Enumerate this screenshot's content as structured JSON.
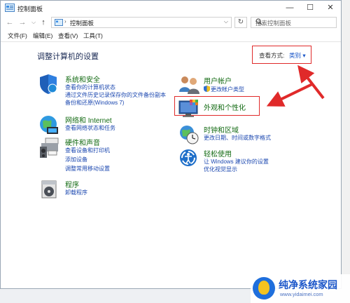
{
  "window": {
    "title": "控制面板"
  },
  "titlebar": {
    "minimize": "—",
    "maximize": "☐",
    "close": "✕"
  },
  "nav": {
    "back": "←",
    "forward": "→",
    "up": "↑"
  },
  "address": {
    "breadcrumb": "控制面板",
    "separator": "›",
    "dropdown": "⌵",
    "refresh": "↻"
  },
  "search": {
    "placeholder": "搜索控制面板"
  },
  "menu": [
    "文件(F)",
    "编辑(E)",
    "查看(V)",
    "工具(T)"
  ],
  "content": {
    "heading": "调整计算机的设置",
    "view_by_label": "查看方式:",
    "view_by_value": "类别 ▾"
  },
  "categories": {
    "system_security": {
      "title": "系统和安全",
      "links": [
        "查看你的计算机状态",
        "通过文件历史记录保存你的文件备份副本",
        "备份和还原(Windows 7)"
      ]
    },
    "network": {
      "title": "网络和 Internet",
      "links": [
        "查看网络状态和任务"
      ]
    },
    "hardware": {
      "title": "硬件和声音",
      "links": [
        "查看设备和打印机",
        "添加设备",
        "调整常用移动设置"
      ]
    },
    "programs": {
      "title": "程序",
      "links": [
        "卸载程序"
      ]
    },
    "user_accounts": {
      "title": "用户帐户",
      "links": [
        "更改帐户类型"
      ]
    },
    "appearance": {
      "title": "外观和个性化"
    },
    "clock_region": {
      "title": "时钟和区域",
      "links": [
        "更改日期、时间或数字格式"
      ]
    },
    "ease_access": {
      "title": "轻松使用",
      "links": [
        "让 Windows 建议你的设置",
        "优化视觉显示"
      ]
    }
  },
  "watermark": {
    "title": "纯净系统家园",
    "url": "www.yidaimei.com"
  },
  "colors": {
    "link_blue": "#1c48b0",
    "category_green": "#146b14",
    "annotation_red": "#e02a2a"
  }
}
